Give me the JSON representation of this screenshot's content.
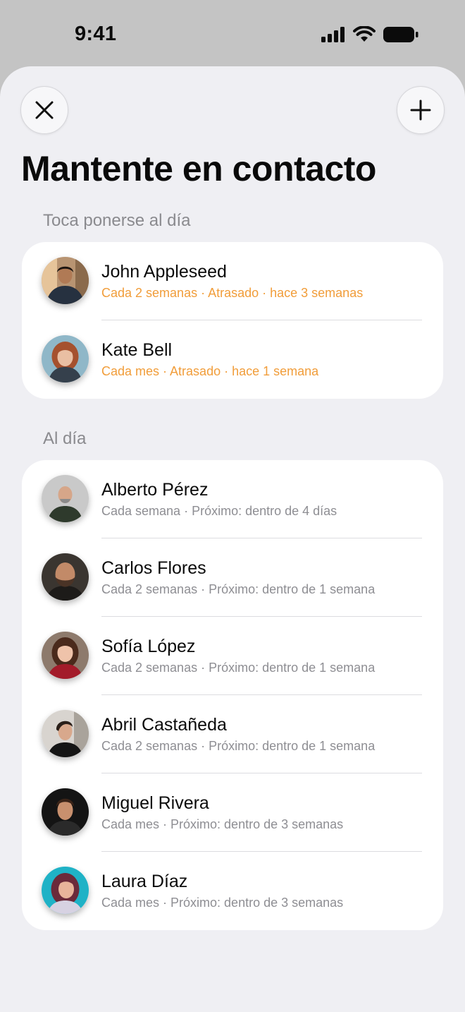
{
  "status_bar": {
    "time": "9:41"
  },
  "header": {
    "title": "Mantente en contacto"
  },
  "sections": [
    {
      "title": "Toca ponerse al día",
      "items": [
        {
          "name": "John Appleseed",
          "subtitle": "Cada 2 semanas · Atrasado · hace 3 semanas"
        },
        {
          "name": "Kate Bell",
          "subtitle": "Cada mes · Atrasado · hace 1 semana"
        }
      ]
    },
    {
      "title": "Al día",
      "items": [
        {
          "name": "Alberto Pérez",
          "subtitle": "Cada semana · Próximo: dentro de 4 días"
        },
        {
          "name": "Carlos Flores",
          "subtitle": "Cada 2 semanas · Próximo: dentro de 1 semana"
        },
        {
          "name": "Sofía López",
          "subtitle": "Cada 2 semanas · Próximo: dentro de 1 semana"
        },
        {
          "name": "Abril Castañeda",
          "subtitle": "Cada 2 semanas · Próximo: dentro de 1 semana"
        },
        {
          "name": "Miguel Rivera",
          "subtitle": "Cada mes · Próximo: dentro de 3 semanas"
        },
        {
          "name": "Laura Díaz",
          "subtitle": "Cada mes · Próximo: dentro de 3 semanas"
        }
      ]
    }
  ],
  "colors": {
    "overdue": "#f19d3a",
    "secondary_text": "#8e8e93",
    "background": "#efeff3"
  }
}
